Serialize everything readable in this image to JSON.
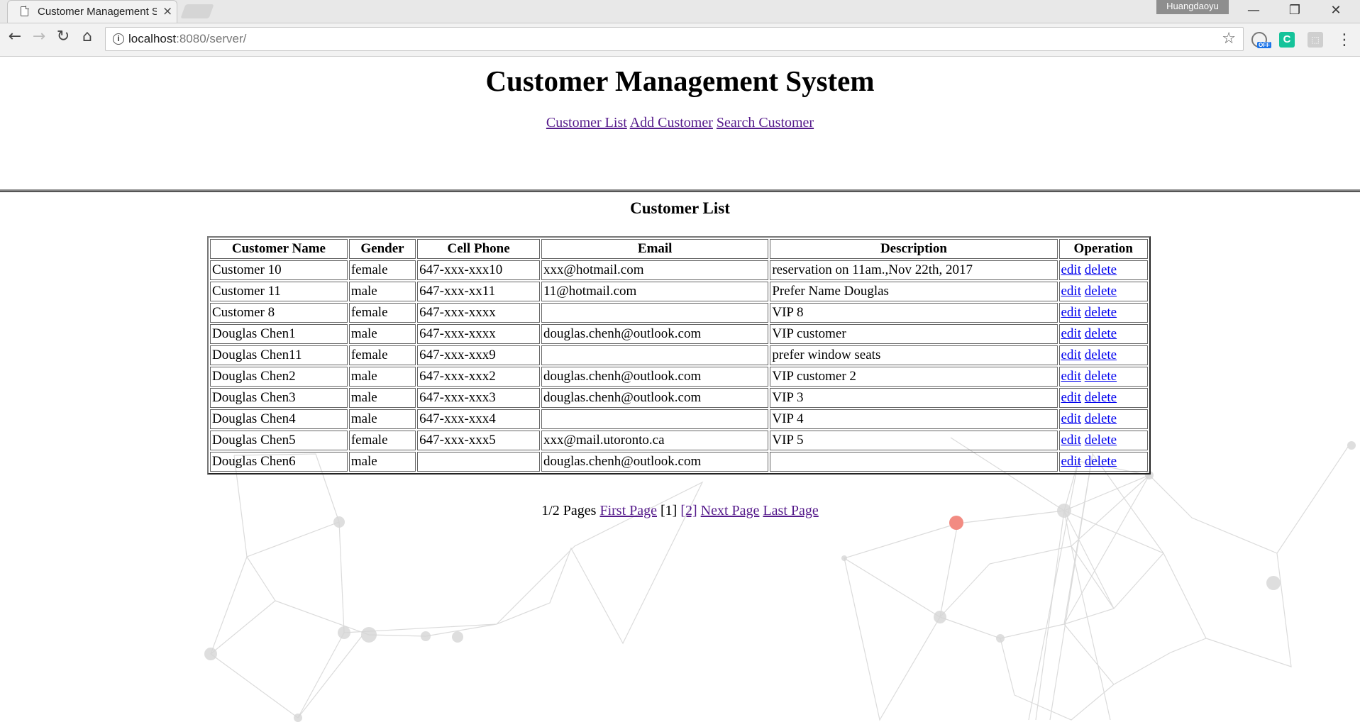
{
  "browser": {
    "tab_title": "Customer Management System",
    "tab_close": "×",
    "profile_name": "Huangdaoyu",
    "url_host": "localhost",
    "url_rest": ":8080/server/",
    "ext_off_badge": "OFF",
    "ext_c_label": "C",
    "window_minimize": "—",
    "window_restore": "❐",
    "window_close": "✕"
  },
  "header": {
    "title": "Customer Management System",
    "nav": [
      {
        "label": "Customer List"
      },
      {
        "label": "Add Customer"
      },
      {
        "label": "Search Customer"
      }
    ]
  },
  "list": {
    "title": "Customer List",
    "columns": [
      "Customer Name",
      "Gender",
      "Cell Phone",
      "Email",
      "Description",
      "Operation"
    ],
    "rows": [
      {
        "name": "Customer 10",
        "gender": "female",
        "phone": "647-xxx-xxx10",
        "email": "xxx@hotmail.com",
        "description": "reservation on 11am.,Nov 22th, 2017"
      },
      {
        "name": "Customer 11",
        "gender": "male",
        "phone": "647-xxx-xx11",
        "email": "11@hotmail.com",
        "description": "Prefer Name Douglas"
      },
      {
        "name": "Customer 8",
        "gender": "female",
        "phone": "647-xxx-xxxx",
        "email": "",
        "description": "VIP 8"
      },
      {
        "name": "Douglas Chen1",
        "gender": "male",
        "phone": "647-xxx-xxxx",
        "email": "douglas.chenh@outlook.com",
        "description": "VIP customer"
      },
      {
        "name": "Douglas Chen11",
        "gender": "female",
        "phone": "647-xxx-xxx9",
        "email": "",
        "description": "prefer window seats"
      },
      {
        "name": "Douglas Chen2",
        "gender": "male",
        "phone": "647-xxx-xxx2",
        "email": "douglas.chenh@outlook.com",
        "description": "VIP customer 2"
      },
      {
        "name": "Douglas Chen3",
        "gender": "male",
        "phone": "647-xxx-xxx3",
        "email": "douglas.chenh@outlook.com",
        "description": "VIP 3"
      },
      {
        "name": "Douglas Chen4",
        "gender": "male",
        "phone": "647-xxx-xxx4",
        "email": "",
        "description": "VIP 4"
      },
      {
        "name": "Douglas Chen5",
        "gender": "female",
        "phone": "647-xxx-xxx5",
        "email": "xxx@mail.utoronto.ca",
        "description": "VIP 5"
      },
      {
        "name": "Douglas Chen6",
        "gender": "male",
        "phone": "",
        "email": "douglas.chenh@outlook.com",
        "description": ""
      }
    ],
    "operation_labels": {
      "edit": "edit",
      "delete": "delete"
    }
  },
  "pager": {
    "summary": "1/2 Pages",
    "first": "First Page",
    "current": "[1]",
    "page2": "[2]",
    "next": "Next Page",
    "last": "Last Page"
  },
  "colors": {
    "link_visited": "#551a8b",
    "link_unvisited": "#0000ee",
    "highlight_node": "#f28b82"
  }
}
